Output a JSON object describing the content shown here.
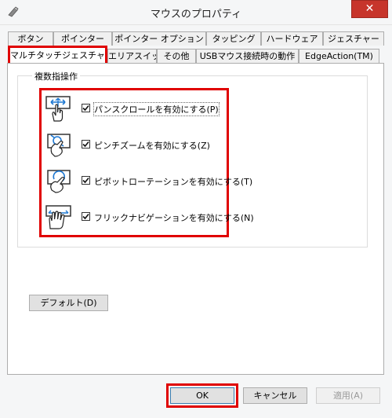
{
  "window": {
    "title": "マウスのプロパティ",
    "close_glyph": "✕",
    "app_icon": "mouse-icon"
  },
  "tabs_row1": [
    {
      "label": "ボタン"
    },
    {
      "label": "ポインター"
    },
    {
      "label": "ポインター オプション"
    },
    {
      "label": "タッピング"
    },
    {
      "label": "ハードウェア"
    },
    {
      "label": "ジェスチャー"
    }
  ],
  "tabs_row2": [
    {
      "label": "マルチタッチジェスチャー",
      "active": true
    },
    {
      "label": "エリアスイッチ"
    },
    {
      "label": "その他"
    },
    {
      "label": "USBマウス接続時の動作"
    },
    {
      "label": "EdgeAction(TM)"
    }
  ],
  "group": {
    "label": "複数指操作",
    "options": [
      {
        "label": "パンスクロールを有効にする(P)",
        "checked": true,
        "icon": "two-finger-scroll-icon"
      },
      {
        "label": "ピンチズームを有効にする(Z)",
        "checked": true,
        "icon": "pinch-zoom-icon"
      },
      {
        "label": "ピボットローテーションを有効にする(T)",
        "checked": true,
        "icon": "pivot-rotate-icon"
      },
      {
        "label": "フリックナビゲーションを有効にする(N)",
        "checked": true,
        "icon": "flick-navigation-icon"
      }
    ]
  },
  "default_button": "デフォルト(D)",
  "footer": {
    "ok": "OK",
    "cancel": "キャンセル",
    "apply": "適用(A)"
  },
  "colors": {
    "highlight": "#e00000",
    "window_bg": "#f5f6f7",
    "close_bg": "#c7352b",
    "icon_blue": "#1e78d2"
  }
}
